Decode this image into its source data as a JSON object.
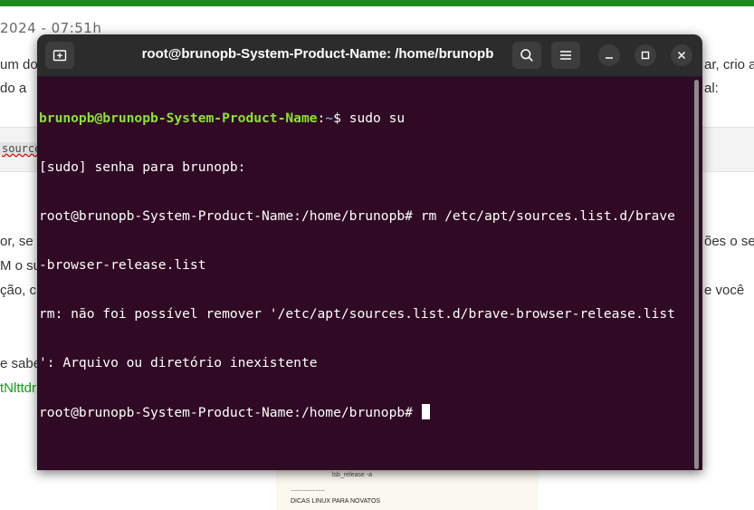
{
  "background": {
    "date": "2024 - 07:51h",
    "text_left_1": "um dos",
    "text_left_2": "do a",
    "text_right_1": "ar, crio a",
    "text_right_2": "al:",
    "code_snippet": "sources.",
    "para_left_1": "or, se v",
    "para_left_2": "M o su",
    "para_left_3": "ção, c",
    "para_right_1": "ões o se",
    "para_right_2": "e você",
    "line_sabe": "e sabe",
    "link_text": "tNlttdr",
    "doc_line_1": "lsb_release -a",
    "doc_line_2": "..........................",
    "doc_line_3": "DICAS LINUX PARA NOVATOS"
  },
  "window": {
    "title": "root@brunopb-System-Product-Name: /home/brunopb",
    "icons": {
      "new_tab": "new-tab-icon",
      "search": "search-icon",
      "menu": "hamburger-menu-icon",
      "minimize": "minimize-icon",
      "maximize": "maximize-icon",
      "close": "close-icon"
    }
  },
  "terminal": {
    "prompt_user": "brunopb@brunopb-System-Product-Name",
    "prompt_sep": ":",
    "prompt_path": "~",
    "prompt_symbol": "$ ",
    "command_1": "sudo su",
    "line_2": "[sudo] senha para brunopb:",
    "line_3": "root@brunopb-System-Product-Name:/home/brunopb# rm /etc/apt/sources.list.d/brave",
    "line_4": "-browser-release.list",
    "line_5": "rm: não foi possível remover '/etc/apt/sources.list.d/brave-browser-release.list",
    "line_6": "': Arquivo ou diretório inexistente",
    "line_7": "root@brunopb-System-Product-Name:/home/brunopb# "
  },
  "colors": {
    "terminal_bg": "#300a24",
    "prompt_user": "#8ae234",
    "prompt_path": "#729fcf",
    "titlebar": "#2c2c2c",
    "page_accent": "#1e8a1e"
  }
}
